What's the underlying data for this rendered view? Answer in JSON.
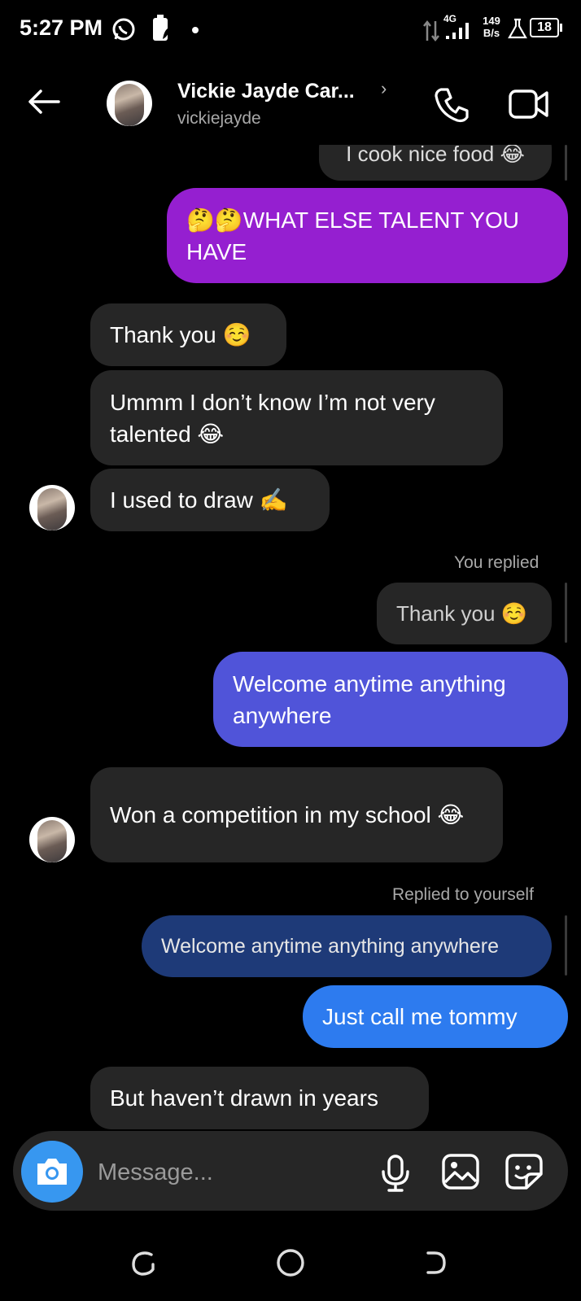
{
  "status_bar": {
    "time": "5:27 PM",
    "network": "4G",
    "speed_value": "149",
    "speed_unit": "B/s",
    "battery": "18"
  },
  "header": {
    "name": "Vickie Jayde Car...",
    "username": "vickiejayde",
    "chevron": "›"
  },
  "messages": {
    "partial_top": "I cook nice food 😂",
    "sent_1": "🤔🤔WHAT ELSE TALENT YOU HAVE",
    "recv_1": "Thank you ☺️",
    "recv_2": "Ummm I don’t know I’m not very talented 😂",
    "recv_3": "I used to draw ✍️",
    "you_replied_label": "You replied",
    "quote_1": "Thank you ☺️",
    "sent_2": "Welcome anytime anything anywhere",
    "recv_4": "Won a competition in my school 😂",
    "replied_to_yourself_label": "Replied to yourself",
    "quote_2": "Welcome anytime anything anywhere",
    "sent_3": "Just call me tommy",
    "recv_5": "But haven’t drawn in years"
  },
  "composer": {
    "placeholder": "Message..."
  },
  "colors": {
    "sent_purple": "#951fd0",
    "sent_indigo": "#5054d9",
    "sent_blue": "#2d7bef",
    "quote_navy": "#1e3a78",
    "received": "#262626",
    "camera": "#3797f0"
  },
  "icons": {
    "back": "back-arrow-icon",
    "phone": "phone-icon",
    "video": "video-camera-icon",
    "camera": "camera-icon",
    "mic": "microphone-icon",
    "gallery": "gallery-icon",
    "sticker": "sticker-icon"
  }
}
